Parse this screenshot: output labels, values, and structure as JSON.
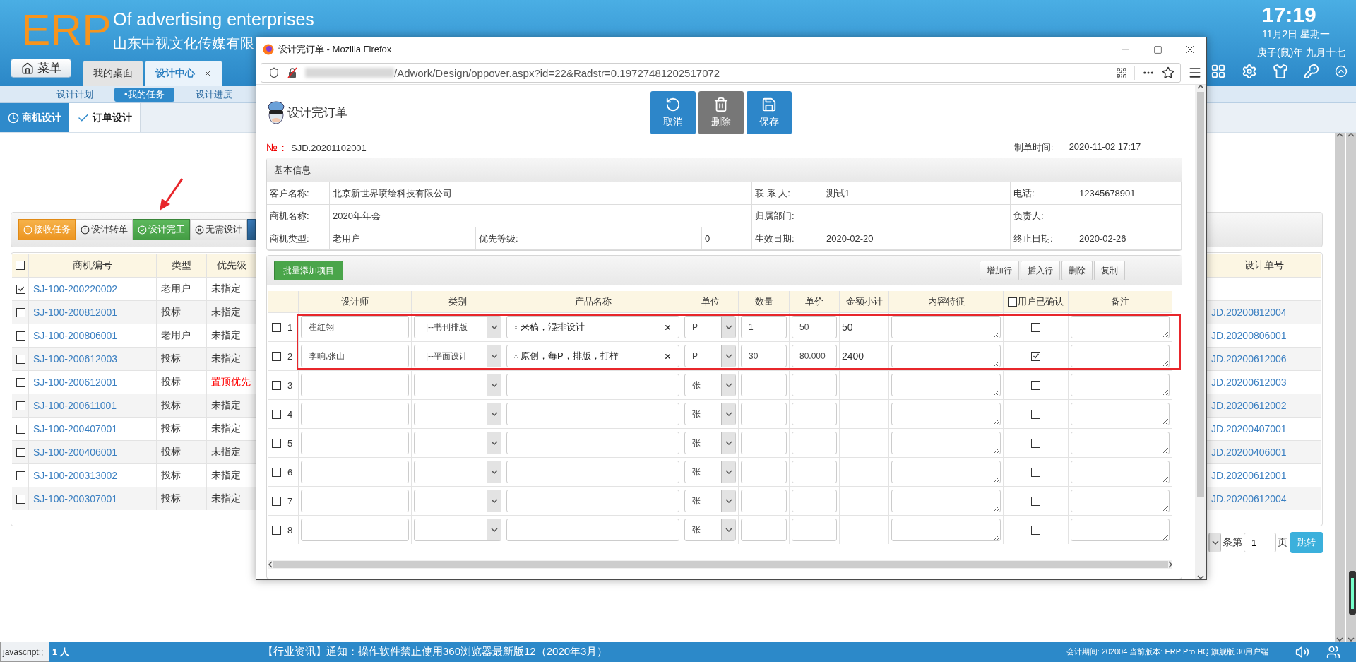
{
  "header": {
    "logo": "ERP",
    "slogan": "Of advertising enterprises",
    "company": "山东中视文化传媒有限",
    "time": "17:19",
    "date": "11月2日 星期一",
    "lunar": "庚子(鼠)年 九月十七"
  },
  "menu_button": "菜单",
  "tabs": [
    {
      "label": "我的桌面",
      "selected": false,
      "closable": false
    },
    {
      "label": "设计中心",
      "selected": true,
      "closable": true
    }
  ],
  "subnav": [
    {
      "label": "设计计划",
      "selected": false
    },
    {
      "label": "•我的任务",
      "selected": true
    },
    {
      "label": "设计进度",
      "selected": false
    }
  ],
  "section_tabs": [
    {
      "label": "商机设计",
      "selected": true
    },
    {
      "label": "订单设计",
      "selected": false
    }
  ],
  "actions": [
    {
      "label": "接收任务",
      "kind": "receive"
    },
    {
      "label": "设计转单",
      "kind": "transfer"
    },
    {
      "label": "设计完工",
      "kind": "complete"
    },
    {
      "label": "无需设计",
      "kind": "skip"
    },
    {
      "kind": "more"
    }
  ],
  "list": {
    "all_checked": false,
    "columns": [
      "商机编号",
      "类型",
      "优先级"
    ],
    "right_column": "设计单号",
    "rows": [
      {
        "checked": true,
        "code": "SJ-100-200220002",
        "type": "老用户",
        "priority": "未指定",
        "urgent": false
      },
      {
        "checked": false,
        "code": "SJ-100-200812001",
        "type": "投标",
        "priority": "未指定",
        "urgent": false,
        "design_no": "JD.20200812004"
      },
      {
        "checked": false,
        "code": "SJ-100-200806001",
        "type": "老用户",
        "priority": "未指定",
        "urgent": false,
        "design_no": "JD.20200806001"
      },
      {
        "checked": false,
        "code": "SJ-100-200612003",
        "type": "投标",
        "priority": "未指定",
        "urgent": false,
        "design_no": "JD.20200612006"
      },
      {
        "checked": false,
        "code": "SJ-100-200612001",
        "type": "投标",
        "priority": "置顶优先",
        "urgent": true,
        "design_no": "JD.20200612003"
      },
      {
        "checked": false,
        "code": "SJ-100-200611001",
        "type": "投标",
        "priority": "未指定",
        "urgent": false,
        "design_no": "JD.20200612002"
      },
      {
        "checked": false,
        "code": "SJ-100-200407001",
        "type": "投标",
        "priority": "未指定",
        "urgent": false,
        "design_no": "JD.20200407001"
      },
      {
        "checked": false,
        "code": "SJ-100-200406001",
        "type": "投标",
        "priority": "未指定",
        "urgent": false,
        "design_no": "JD.20200406001"
      },
      {
        "checked": false,
        "code": "SJ-100-200313002",
        "type": "投标",
        "priority": "未指定",
        "urgent": false,
        "design_no": "JD.20200612001"
      },
      {
        "checked": false,
        "code": "SJ-100-200307001",
        "type": "投标",
        "priority": "未指定",
        "urgent": false,
        "design_no": "JD.20200612004"
      }
    ]
  },
  "pagination": {
    "per_page_suffix": "条第",
    "page": "1",
    "page_suffix": "页",
    "go": "跳转"
  },
  "status_bar": {
    "link_hint": "javascript:;",
    "online": "1 人",
    "notice": "【行业资讯】通知：操作软件禁止使用360浏览器最新版12（2020年3月）",
    "info": "会计期间: 202004 当前版本: ERP Pro HQ 旗舰版 30用户端"
  },
  "popup": {
    "window_title": "设计完订单 - Mozilla Firefox",
    "url": "/Adwork/Design/oppover.aspx?id=22&Radstr=0.19727481202517072",
    "page_title": "设计完订单",
    "buttons": [
      {
        "label": "取消",
        "kind": "undo"
      },
      {
        "label": "删除",
        "kind": "delete"
      },
      {
        "label": "保存",
        "kind": "save"
      }
    ],
    "no_label": "№：",
    "no": "SJD.20201102001",
    "made_label": "制单时间:",
    "made_time": "2020-11-02 17:17",
    "info_title": "基本信息",
    "info_rows": [
      [
        {
          "label": "客户名称:",
          "value": "北京新世界喷绘科技有限公司"
        },
        {
          "label": "联 系 人:",
          "value": "测试1"
        },
        {
          "label": "电话:",
          "value": "12345678901"
        }
      ],
      [
        {
          "label": "商机名称:",
          "value": "2020年年会"
        },
        {
          "label": "归属部门:"
        },
        {
          "label": "负责人:"
        }
      ],
      [
        {
          "label": "商机类型:",
          "value": "老用户"
        },
        {
          "label": "优先等级:",
          "value": "0"
        },
        {
          "label": "生效日期:",
          "value": "2020-02-20"
        },
        {
          "label": "终止日期:",
          "value": "2020-02-26"
        }
      ]
    ],
    "items": {
      "bulk_add": "批量添加项目",
      "row_tools": [
        "增加行",
        "插入行",
        "删除",
        "复制"
      ],
      "confirm_all_checked": false,
      "columns": [
        "设计师",
        "类别",
        "产品名称",
        "单位",
        "数量",
        "单价",
        "金额小计",
        "内容特征",
        "用户已确认",
        "备注"
      ],
      "rows": [
        {
          "no": "1",
          "checked": false,
          "highlighted": true,
          "designer": "崔红翎",
          "category": "|--书刊排版",
          "products": "来稿，混排设计",
          "unit": "P",
          "qty": "1",
          "price": "50",
          "subtotal": "50",
          "confirmed": false
        },
        {
          "no": "2",
          "checked": false,
          "highlighted": true,
          "designer": "李晌,张山",
          "category": "|--平面设计",
          "products": "原创，每P，排版，打样",
          "unit": "P",
          "qty": "30",
          "price": "80.000",
          "subtotal": "2400",
          "confirmed": true
        },
        {
          "no": "3",
          "checked": false,
          "highlighted": false,
          "unit": "张",
          "confirmed": false
        },
        {
          "no": "4",
          "checked": false,
          "highlighted": false,
          "unit": "张",
          "confirmed": false
        },
        {
          "no": "5",
          "checked": false,
          "highlighted": false,
          "unit": "张",
          "confirmed": false
        },
        {
          "no": "6",
          "checked": false,
          "highlighted": false,
          "unit": "张",
          "confirmed": false
        },
        {
          "no": "7",
          "checked": false,
          "highlighted": false,
          "unit": "张",
          "confirmed": false
        },
        {
          "no": "8",
          "checked": false,
          "highlighted": false,
          "unit": "张",
          "confirmed": false
        }
      ]
    }
  }
}
